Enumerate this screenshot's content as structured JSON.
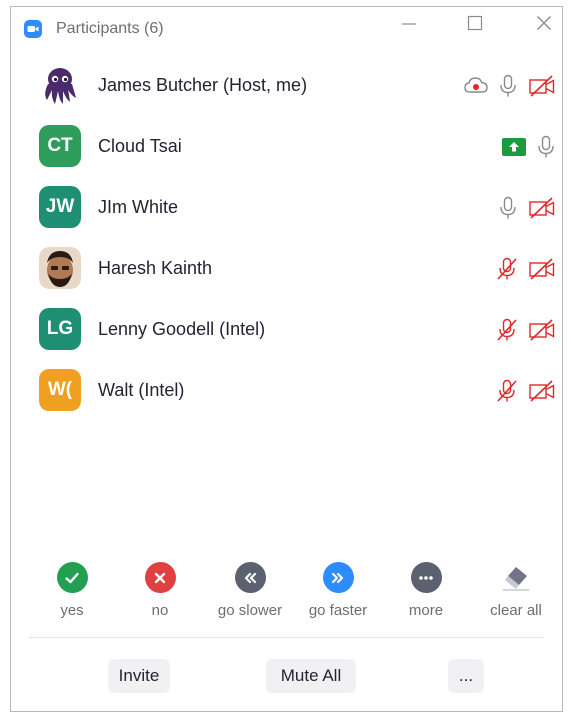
{
  "window": {
    "title": "Participants (6)"
  },
  "participants": [
    {
      "name": "James Butcher  (Host, me)",
      "initials": "",
      "avatar": "octopus-image",
      "avatar_color": "#4a2a6a",
      "icons": [
        "cloud-record-icon",
        "microphone-icon",
        "video-off-icon"
      ]
    },
    {
      "name": "Cloud Tsai",
      "initials": "CT",
      "avatar_color": "#2e9c5a",
      "icons": [
        "screen-share-icon",
        "microphone-icon"
      ]
    },
    {
      "name": "JIm White",
      "initials": "JW",
      "avatar_color": "#1f8f74",
      "icons": [
        "microphone-icon",
        "video-off-icon"
      ]
    },
    {
      "name": "Haresh Kainth",
      "initials": "",
      "avatar": "face-photo",
      "avatar_color": "#6b4a35",
      "icons": [
        "microphone-muted-icon",
        "video-off-icon"
      ]
    },
    {
      "name": "Lenny Goodell (Intel)",
      "initials": "LG",
      "avatar_color": "#1f8f74",
      "icons": [
        "microphone-muted-icon",
        "video-off-icon"
      ]
    },
    {
      "name": "Walt (Intel)",
      "initials": "W(",
      "avatar_color": "#f0a020",
      "icons": [
        "microphone-muted-icon",
        "video-off-icon"
      ]
    }
  ],
  "reactions": [
    {
      "label": "yes",
      "icon": "checkmark-icon",
      "color": "#20a050"
    },
    {
      "label": "no",
      "icon": "x-icon",
      "color": "#e04040"
    },
    {
      "label": "go slower",
      "icon": "rewind-icon",
      "color": "#5c6170"
    },
    {
      "label": "go faster",
      "icon": "fast-forward-icon",
      "color": "#2d8cff"
    },
    {
      "label": "more",
      "icon": "ellipsis-icon",
      "color": "#5c6170"
    },
    {
      "label": "clear all",
      "icon": "eraser-icon",
      "color": "#747487"
    }
  ],
  "footer": {
    "invite_label": "Invite",
    "mute_all_label": "Mute All",
    "more_label": "..."
  },
  "colors": {
    "red_icon": "#e02828",
    "gray_icon": "#8a8a8a",
    "share_green": "#1c9a3e",
    "brand_blue": "#2d8cff"
  }
}
